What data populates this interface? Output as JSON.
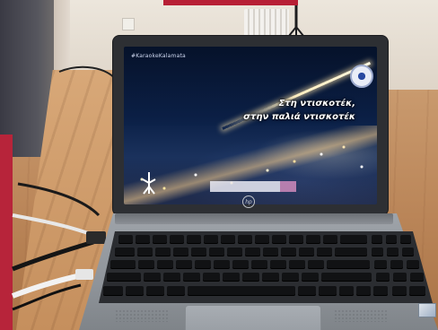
{
  "screen": {
    "hashtag": "#KaraokeKalamata",
    "lyric_line1": "Στη ντισκοτέκ,",
    "lyric_line2": "στην παλιά ντισκοτέκ"
  },
  "laptop": {
    "brand_logo": "hp"
  },
  "colors": {
    "frame_red": "#b7243a",
    "screen_night": "#0b1f45",
    "laptop_silver": "#9ea3a9"
  }
}
